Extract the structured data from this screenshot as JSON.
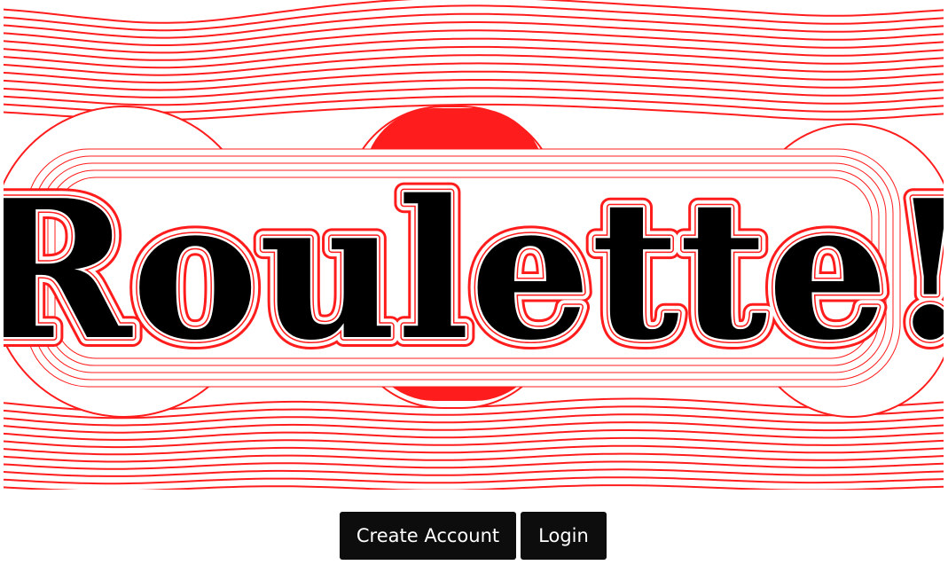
{
  "hero": {
    "title": "Roulette!",
    "accent_color": "#ff1c1c",
    "ink_color": "#000000",
    "background_color": "#ffffff"
  },
  "actions": {
    "create_account_label": "Create Account",
    "login_label": "Login"
  }
}
